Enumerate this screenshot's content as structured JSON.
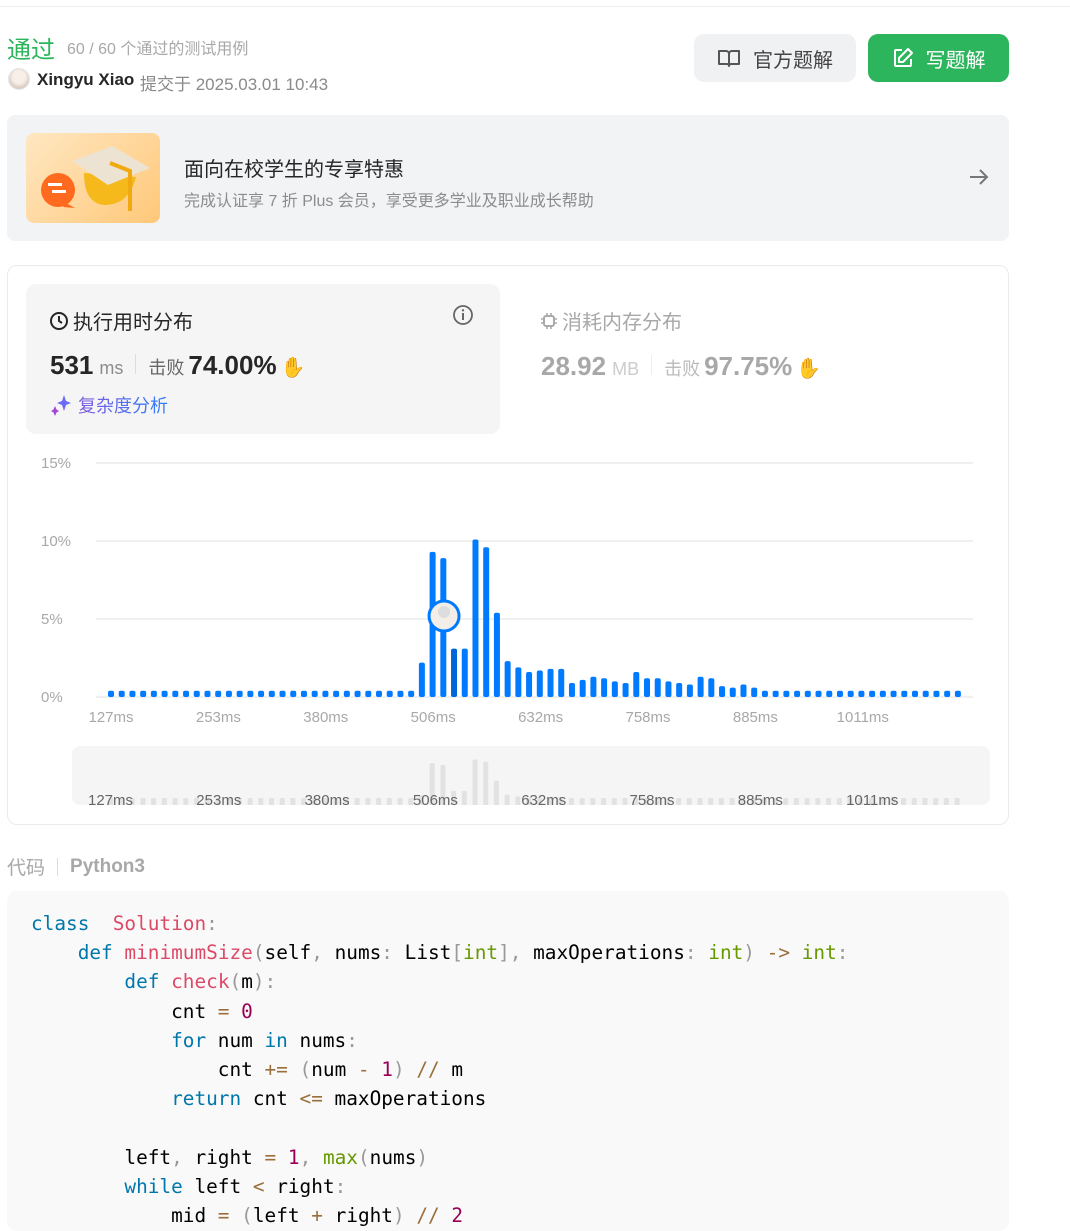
{
  "header": {
    "status": "通过",
    "cases": "60 / 60 个通过的测试用例",
    "user": "Xingyu Xiao",
    "submitted": "提交于 2025.03.01 10:43",
    "official_solution": "官方题解",
    "write_solution": "写题解"
  },
  "promo": {
    "title": "面向在校学生的专享特惠",
    "subtitle": "完成认证享 7 折 Plus 会员，享受更多学业及职业成长帮助"
  },
  "runtime": {
    "title": "执行用时分布",
    "value": "531",
    "unit": "ms",
    "beat_label": "击败",
    "beat": "74.00%",
    "analysis": "复杂度分析"
  },
  "memory": {
    "title": "消耗内存分布",
    "value": "28.92",
    "unit": "MB",
    "beat_label": "击败",
    "beat": "97.75%"
  },
  "colors": {
    "accent": "#2db55d",
    "bar": "#007aff",
    "bar_user": "#0066d6"
  },
  "chart_data": {
    "type": "bar",
    "ylabel": "",
    "xlabel": "",
    "ylim": [
      0,
      15
    ],
    "y_ticks": [
      "15%",
      "10%",
      "5%",
      "0%"
    ],
    "x_ticks": [
      "127ms",
      "253ms",
      "380ms",
      "506ms",
      "632ms",
      "758ms",
      "885ms",
      "1011ms"
    ],
    "user_bar_index": 32,
    "values": [
      0.4,
      0.4,
      0.4,
      0.4,
      0.4,
      0.4,
      0.4,
      0.4,
      0.4,
      0.4,
      0.4,
      0.4,
      0.4,
      0.4,
      0.4,
      0.4,
      0.4,
      0.4,
      0.4,
      0.4,
      0.4,
      0.4,
      0.4,
      0.4,
      0.4,
      0.4,
      0.4,
      0.4,
      0.4,
      2.2,
      9.3,
      8.9,
      3.1,
      3.1,
      10.1,
      9.6,
      5.4,
      2.3,
      1.9,
      1.6,
      1.7,
      1.8,
      1.8,
      0.9,
      1.1,
      1.3,
      1.2,
      1.0,
      0.9,
      1.6,
      1.2,
      1.2,
      1.0,
      0.9,
      0.8,
      1.3,
      1.2,
      0.7,
      0.6,
      0.8,
      0.6,
      0.4,
      0.4,
      0.4,
      0.4,
      0.4,
      0.4,
      0.4,
      0.4,
      0.4,
      0.4,
      0.4,
      0.4,
      0.4,
      0.4,
      0.4,
      0.4,
      0.4,
      0.4,
      0.4
    ]
  },
  "code": {
    "label": "代码",
    "language": "Python3",
    "lines": [
      [
        [
          "kw",
          "class"
        ],
        [
          "",
          "  "
        ],
        [
          "fn",
          "Solution"
        ],
        [
          "p",
          ":"
        ]
      ],
      [
        [
          "",
          "    "
        ],
        [
          "kw",
          "def"
        ],
        [
          "",
          " "
        ],
        [
          "fn",
          "minimumSize"
        ],
        [
          "p",
          "("
        ],
        [
          "",
          "self"
        ],
        [
          "p",
          ","
        ],
        [
          "",
          " nums"
        ],
        [
          "p",
          ":"
        ],
        [
          "",
          " List"
        ],
        [
          "p",
          "["
        ],
        [
          "bi",
          "int"
        ],
        [
          "p",
          "],"
        ],
        [
          "",
          " maxOperations"
        ],
        [
          "p",
          ":"
        ],
        [
          "",
          " "
        ],
        [
          "bi",
          "int"
        ],
        [
          "p",
          ")"
        ],
        [
          "",
          " "
        ],
        [
          "op",
          "->"
        ],
        [
          "",
          " "
        ],
        [
          "bi",
          "int"
        ],
        [
          "p",
          ":"
        ]
      ],
      [
        [
          "",
          "        "
        ],
        [
          "kw",
          "def"
        ],
        [
          "",
          " "
        ],
        [
          "fn",
          "check"
        ],
        [
          "p",
          "("
        ],
        [
          "",
          "m"
        ],
        [
          "p",
          "):"
        ]
      ],
      [
        [
          "",
          "            cnt "
        ],
        [
          "op",
          "="
        ],
        [
          "",
          " "
        ],
        [
          "num",
          "0"
        ]
      ],
      [
        [
          "",
          "            "
        ],
        [
          "kw",
          "for"
        ],
        [
          "",
          " num "
        ],
        [
          "kw",
          "in"
        ],
        [
          "",
          " nums"
        ],
        [
          "p",
          ":"
        ]
      ],
      [
        [
          "",
          "                cnt "
        ],
        [
          "op",
          "+="
        ],
        [
          "",
          " "
        ],
        [
          "p",
          "("
        ],
        [
          "",
          "num "
        ],
        [
          "op",
          "-"
        ],
        [
          "",
          " "
        ],
        [
          "num",
          "1"
        ],
        [
          "p",
          ")"
        ],
        [
          "",
          " "
        ],
        [
          "op",
          "//"
        ],
        [
          "",
          " m"
        ]
      ],
      [
        [
          "",
          "            "
        ],
        [
          "kw",
          "return"
        ],
        [
          "",
          " cnt "
        ],
        [
          "op",
          "<="
        ],
        [
          "",
          " maxOperations"
        ]
      ],
      [
        [
          "",
          ""
        ]
      ],
      [
        [
          "",
          "        left"
        ],
        [
          "p",
          ","
        ],
        [
          "",
          " right "
        ],
        [
          "op",
          "="
        ],
        [
          "",
          " "
        ],
        [
          "num",
          "1"
        ],
        [
          "p",
          ","
        ],
        [
          "",
          " "
        ],
        [
          "bi",
          "max"
        ],
        [
          "p",
          "("
        ],
        [
          "",
          "nums"
        ],
        [
          "p",
          ")"
        ]
      ],
      [
        [
          "",
          "        "
        ],
        [
          "kw",
          "while"
        ],
        [
          "",
          " left "
        ],
        [
          "op",
          "<"
        ],
        [
          "",
          " right"
        ],
        [
          "p",
          ":"
        ]
      ],
      [
        [
          "",
          "            mid "
        ],
        [
          "op",
          "="
        ],
        [
          "",
          " "
        ],
        [
          "p",
          "("
        ],
        [
          "",
          "left "
        ],
        [
          "op",
          "+"
        ],
        [
          "",
          " right"
        ],
        [
          "p",
          ")"
        ],
        [
          "",
          " "
        ],
        [
          "op",
          "//"
        ],
        [
          "",
          " "
        ],
        [
          "num",
          "2"
        ]
      ]
    ]
  }
}
